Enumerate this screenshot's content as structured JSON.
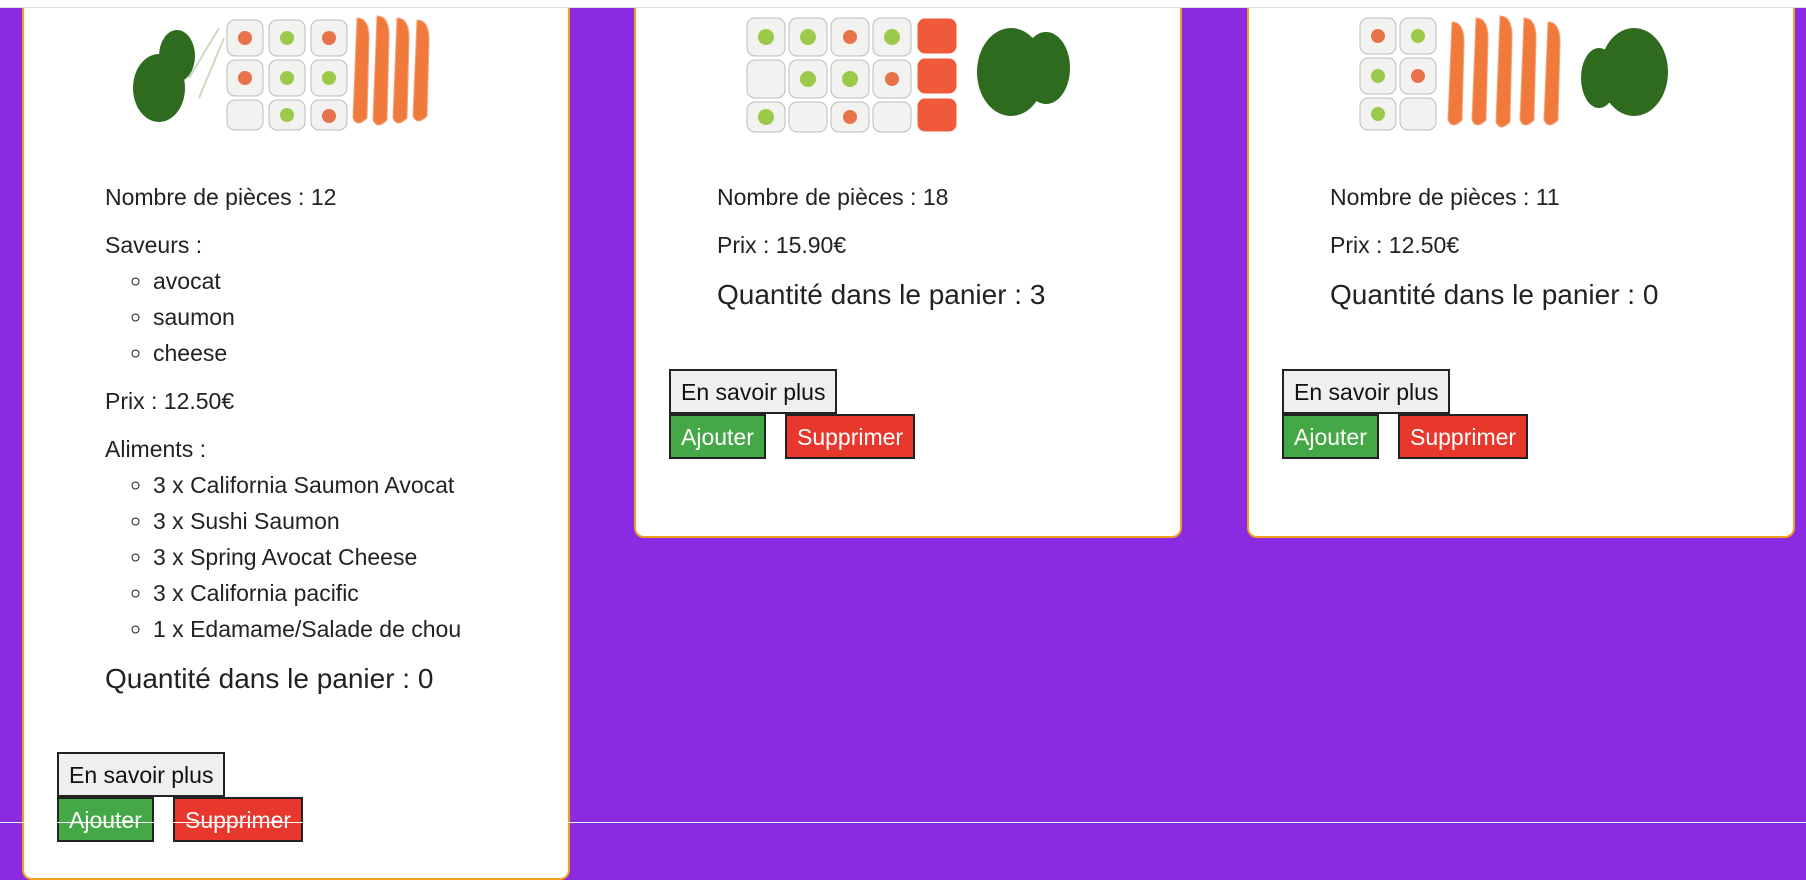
{
  "colors": {
    "background": "#8a2be2",
    "card_border": "#f29e1f",
    "add": "#45a847",
    "delete": "#e8382e"
  },
  "products": [
    {
      "pieces": "Nombre de pièces : 12",
      "flavors_label": "Saveurs :",
      "flavors": [
        "avocat",
        "saumon",
        "cheese"
      ],
      "price": "Prix : 12.50€",
      "foods_label": "Aliments :",
      "foods": [
        "3 x California Saumon Avocat",
        "3 x Sushi Saumon",
        "3 x Spring Avocat Cheese",
        "3 x California pacific",
        "1 x Edamame/Salade de chou"
      ],
      "quantity": "Quantité dans le panier : 0",
      "more_label": "En savoir plus",
      "add_label": "Ajouter",
      "delete_label": "Supprimer",
      "image_icon": "sushi-platter-icon"
    },
    {
      "pieces": "Nombre de pièces : 18",
      "price": "Prix : 15.90€",
      "quantity": "Quantité dans le panier : 3",
      "more_label": "En savoir plus",
      "add_label": "Ajouter",
      "delete_label": "Supprimer",
      "image_icon": "sushi-platter-icon"
    },
    {
      "pieces": "Nombre de pièces : 11",
      "price": "Prix : 12.50€",
      "quantity": "Quantité dans le panier : 0",
      "more_label": "En savoir plus",
      "add_label": "Ajouter",
      "delete_label": "Supprimer",
      "image_icon": "sushi-platter-icon"
    }
  ]
}
